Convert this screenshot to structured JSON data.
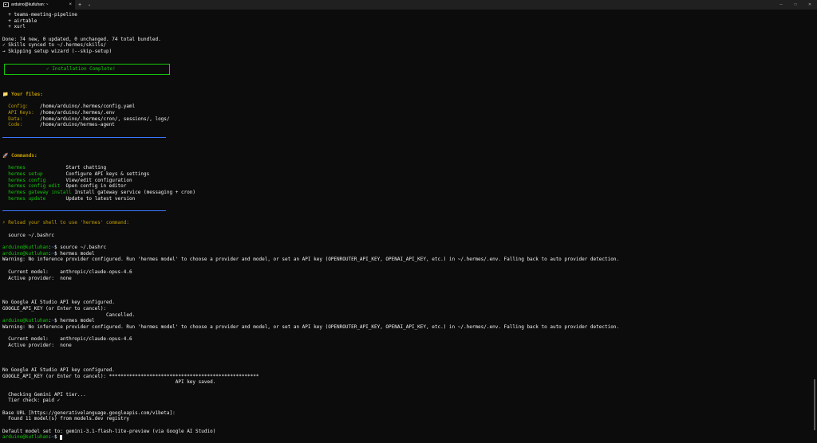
{
  "tab": {
    "title": "arduino@kutluhan: ~",
    "close": "×",
    "new": "+",
    "dropdown": "⌄"
  },
  "window": {
    "minimize": "─",
    "maximize": "□",
    "close": "✕"
  },
  "lines": [
    "  + teams-meeting-pipeline",
    "  + airtable",
    "  + xurl",
    "",
    "Done: 74 new, 0 updated, 0 unchanged. 74 total bundled.",
    "✓ Skills synced to ~/.hermes/skills/",
    "→ Skipping setup wizard (--skip-setup)"
  ],
  "install_box": "✓ Installation Complete!",
  "files": {
    "heading": "📁 Your files:",
    "rows": [
      {
        "label": "  Config:    ",
        "value": "/home/arduino/.hermes/config.yaml"
      },
      {
        "label": "  API Keys:  ",
        "value": "/home/arduino/.hermes/.env"
      },
      {
        "label": "  Data:      ",
        "value": "/home/arduino/.hermes/cron/, sessions/, logs/"
      },
      {
        "label": "  Code:      ",
        "value": "/home/arduino/hermes-agent"
      }
    ]
  },
  "commands": {
    "heading": "🚀 Commands:",
    "rows": [
      {
        "cmd": "  hermes              ",
        "desc": "Start chatting"
      },
      {
        "cmd": "  hermes setup        ",
        "desc": "Configure API keys & settings"
      },
      {
        "cmd": "  hermes config       ",
        "desc": "View/edit configuration"
      },
      {
        "cmd": "  hermes config edit  ",
        "desc": "Open config in editor"
      },
      {
        "cmd": "  hermes gateway install ",
        "desc": "Install gateway service (messaging + cron)"
      },
      {
        "cmd": "  hermes update       ",
        "desc": "Update to latest version"
      }
    ]
  },
  "reload": "⚡ Reload your shell to use 'hermes' command:",
  "source_line": "  source ~/.bashrc",
  "prompt": {
    "user": "arduino@kutluhan",
    "sep": ":",
    "path": "~",
    "dollar": "$ "
  },
  "session": {
    "cmd1": "source ~/.bashrc",
    "cmd2": "hermes model",
    "warning": "Warning: No inference provider configured. Run 'hermes model' to choose a provider and model, or set an API key (OPENROUTER_API_KEY, OPENAI_API_KEY, etc.) in ~/.hermes/.env. Falling back to auto provider detection.",
    "current_model": "  Current model:    anthropic/claude-opus-4.6",
    "active_provider": "  Active provider:  none",
    "no_google": "No Google AI Studio API key configured.",
    "google_prompt": "GOOGLE_API_KEY (or Enter to cancel): ",
    "cancelled": "                                    Cancelled.",
    "cmd3": "hermes model",
    "warning2": "Warning: No inference provider configured. Run 'hermes model' to choose a provider and model, or set an API key (OPENROUTER_API_KEY, OPENAI_API_KEY, etc.) in ~/.hermes/.env. Falling back to auto provider detection.",
    "current_model2": "  Current model:    anthropic/claude-opus-4.6",
    "active_provider2": "  Active provider:  none",
    "no_google2": "No Google AI Studio API key configured.",
    "google_prompt2": "GOOGLE_API_KEY (or Enter to cancel): ****************************************************",
    "key_saved": "                                                            API key saved.",
    "checking": "  Checking Gemini API tier...",
    "tier": "  Tier check: paid ✓",
    "base_url": "Base URL [https://generativelanguage.googleapis.com/v1beta]:",
    "found": "  Found 11 model(s) from models.dev registry",
    "default_model": "Default model set to: gemini-3.1-flash-lite-preview (via Google AI Studio)"
  }
}
